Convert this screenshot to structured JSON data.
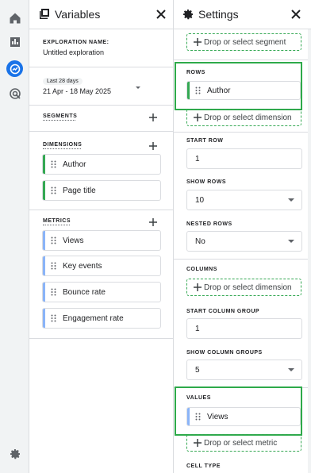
{
  "rail": {
    "items": [
      {
        "icon": "home-icon"
      },
      {
        "icon": "reports-icon"
      },
      {
        "icon": "explore-icon",
        "active": true
      },
      {
        "icon": "advertising-icon"
      }
    ],
    "bottom_icon": "admin-gear-icon"
  },
  "variables": {
    "title": "Variables",
    "exploration_name_label": "EXPLORATION NAME:",
    "exploration_name": "Untitled exploration",
    "date_chip": "Last 28 days",
    "date_range": "21 Apr - 18 May 2025",
    "segments_label": "SEGMENTS",
    "dimensions_label": "DIMENSIONS",
    "dimensions": [
      "Author",
      "Page title"
    ],
    "metrics_label": "METRICS",
    "metrics": [
      "Views",
      "Key events",
      "Bounce rate",
      "Engagement rate"
    ]
  },
  "settings": {
    "title": "Settings",
    "drop_segment": "Drop or select segment",
    "rows_label": "ROWS",
    "rows_item": "Author",
    "drop_dimension": "Drop or select dimension",
    "start_row_label": "START ROW",
    "start_row": "1",
    "show_rows_label": "SHOW ROWS",
    "show_rows": "10",
    "nested_rows_label": "NESTED ROWS",
    "nested_rows": "No",
    "columns_label": "COLUMNS",
    "drop_column_dimension": "Drop or select dimension",
    "start_column_group_label": "START COLUMN GROUP",
    "start_column_group": "1",
    "show_column_groups_label": "SHOW COLUMN GROUPS",
    "show_column_groups": "5",
    "values_label": "VALUES",
    "values_item": "Views",
    "drop_metric": "Drop or select metric",
    "cell_type_label": "CELL TYPE"
  },
  "colors": {
    "dimension_bar": "#34a853",
    "metric_bar": "#8ab4f8",
    "highlight": "#2eaa4a",
    "accent": "#1a73e8"
  }
}
